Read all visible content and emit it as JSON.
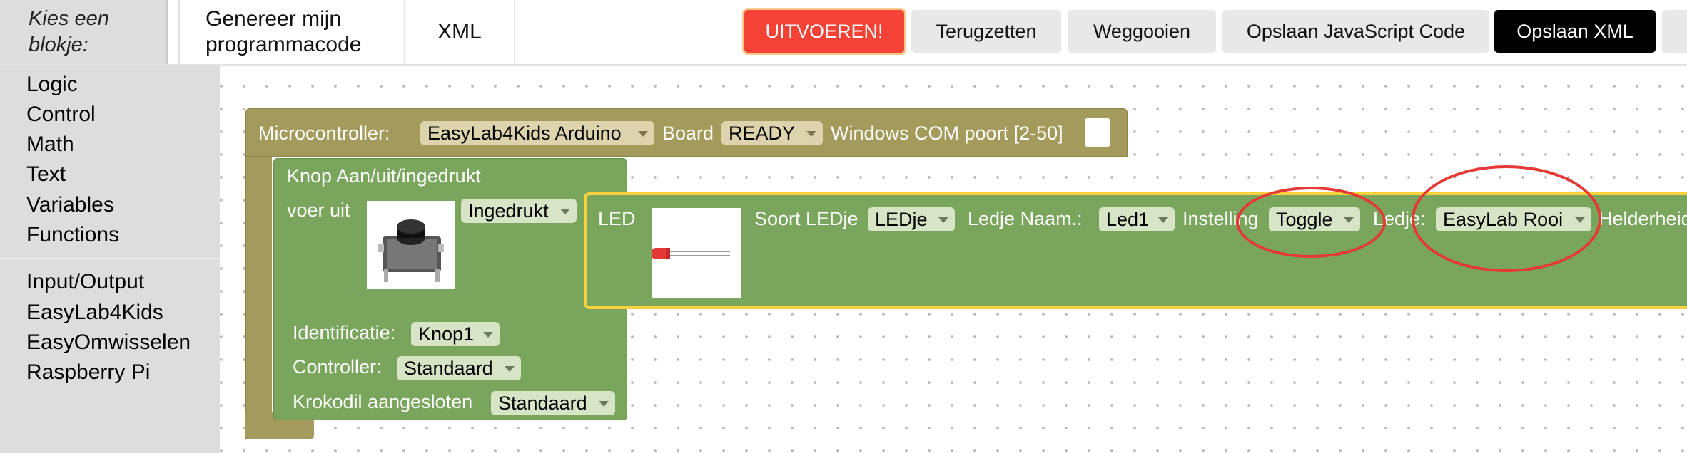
{
  "toolbar": {
    "kies_label": "Kies een blokje:",
    "tab_generate": "Genereer mijn programmacode",
    "tab_xml": "XML",
    "run": "UITVOEREN!",
    "reset": "Terugzetten",
    "discard": "Weggooien",
    "save_js": "Opslaan JavaScript Code",
    "save_xml": "Opslaan XML"
  },
  "toolbox": {
    "group1": [
      "Logic",
      "Control",
      "Math",
      "Text",
      "Variables",
      "Functions"
    ],
    "group2": [
      "Input/Output",
      "EasyLab4Kids",
      "EasyOmwisselen",
      "Raspberry Pi"
    ]
  },
  "microcontroller_block": {
    "label": "Microcontroller:",
    "board_value": "EasyLab4Kids Arduino",
    "board_label": "Board",
    "status_value": "READY",
    "port_label": "Windows COM poort [2-50]"
  },
  "button_block": {
    "title": "Knop Aan/uit/ingedrukt",
    "do_label": "voer uit",
    "state_value": "Ingedrukt",
    "id_label": "Identificatie:",
    "id_value": "Knop1",
    "controller_label": "Controller:",
    "controller_value": "Standaard",
    "croc_label": "Krokodil aangesloten",
    "croc_value": "Standaard"
  },
  "led_block": {
    "title": "LED",
    "type_label": "Soort LEDje",
    "type_value": "LEDje",
    "name_label": "Ledje Naam.:",
    "name_value": "Led1",
    "setting_label": "Instelling",
    "setting_value": "Toggle",
    "ledje_label": "Ledje:",
    "ledje_value": "EasyLab Rooi",
    "brightness_label": "Helderheid"
  },
  "colors": {
    "run_button": "#f44336",
    "save_xml_button": "#000000",
    "controller_block": "#a49a5b",
    "green_block": "#79a55c",
    "selection_outline": "#fad23c",
    "annotation": "#e53935"
  }
}
